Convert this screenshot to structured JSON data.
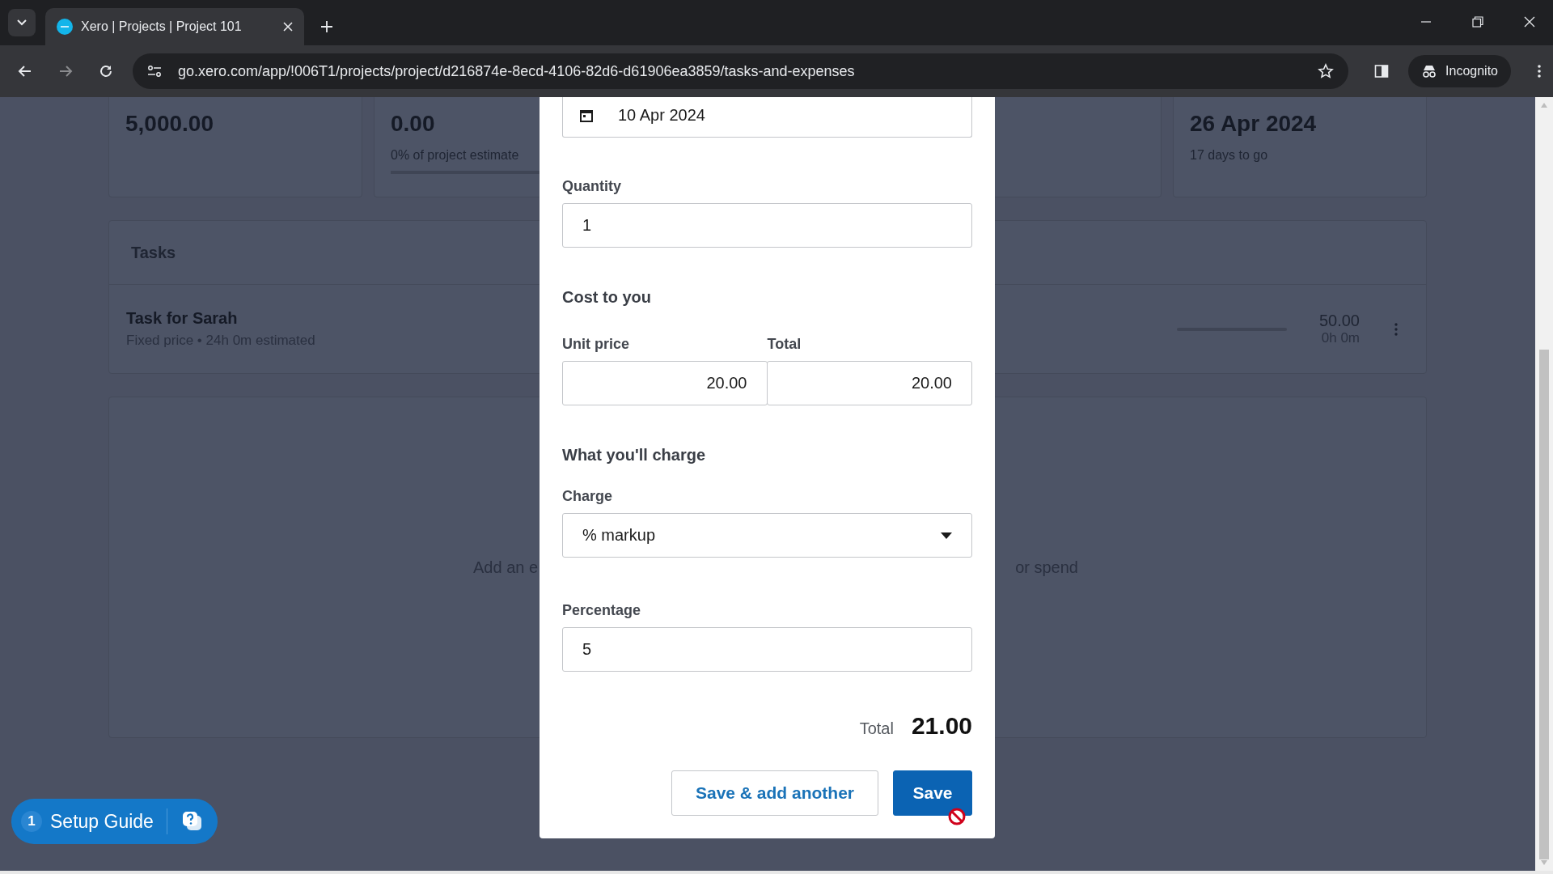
{
  "browser": {
    "tab_title": "Xero | Projects | Project 101",
    "url": "go.xero.com/app/!006T1/projects/project/d216874e-8ecd-4106-82d6-d61906ea3859/tasks-and-expenses",
    "profile": "Incognito"
  },
  "summary_cards": [
    {
      "kind": "amount",
      "value": "5,000.00"
    },
    {
      "kind": "progress",
      "value": "0.00",
      "note": "0% of project estimate",
      "level": 0
    },
    {
      "kind": "blank"
    },
    {
      "kind": "amount",
      "value": "26 Apr 2024",
      "note": "17 days to go"
    }
  ],
  "tasks": {
    "title": "Tasks",
    "rows": [
      {
        "name": "Task for Sarah",
        "details": "Fixed price • 24h 0m estimated",
        "level": 0,
        "amount": "50.00",
        "time": "0h 0m"
      }
    ]
  },
  "expenses_empty": {
    "text_left": "Add an e",
    "text_right": "or spend"
  },
  "modal": {
    "date": "10 Apr 2024",
    "quantity": {
      "label": "Quantity",
      "value": "1"
    },
    "cost_heading": "Cost to you",
    "unit_price": {
      "label": "Unit price",
      "value": "20.00"
    },
    "line_total": {
      "label": "Total",
      "value": "20.00"
    },
    "charge_heading": "What you'll charge",
    "charge": {
      "label": "Charge",
      "value": "% markup"
    },
    "percentage": {
      "label": "Percentage",
      "value": "5"
    },
    "grand_total": {
      "label": "Total",
      "value": "21.00"
    },
    "buttons": [
      {
        "label": "Save & add another",
        "kind": "secondary"
      },
      {
        "label": "Save",
        "kind": "primary"
      }
    ]
  },
  "setup_guide": {
    "count": "1",
    "label": "Setup Guide"
  }
}
